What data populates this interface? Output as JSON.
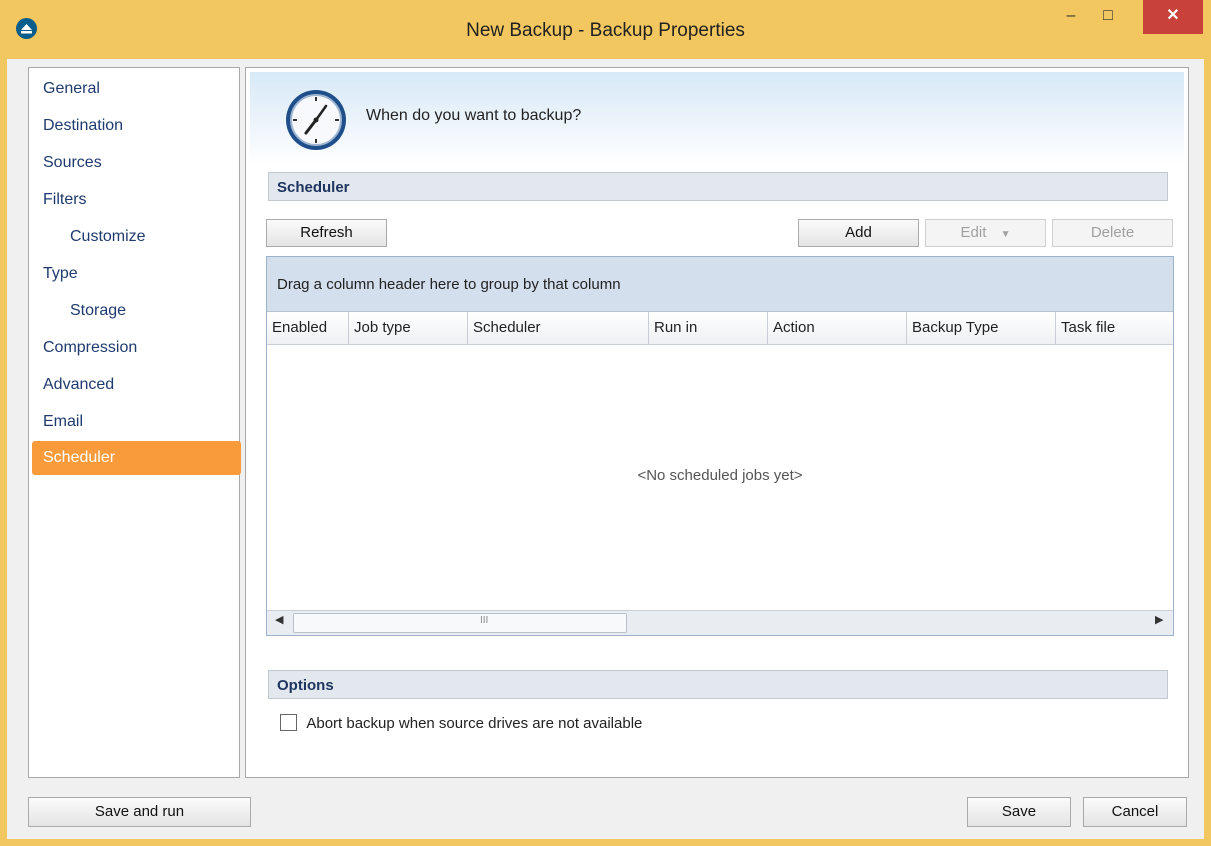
{
  "window": {
    "title": "New Backup - Backup Properties",
    "controls": {
      "minimize": "–",
      "maximize": "□",
      "close": "✕"
    }
  },
  "sidebar": {
    "items": [
      {
        "label": "General",
        "indent": false,
        "active": false
      },
      {
        "label": "Destination",
        "indent": false,
        "active": false
      },
      {
        "label": "Sources",
        "indent": false,
        "active": false
      },
      {
        "label": "Filters",
        "indent": false,
        "active": false
      },
      {
        "label": "Customize",
        "indent": true,
        "active": false
      },
      {
        "label": "Type",
        "indent": false,
        "active": false
      },
      {
        "label": "Storage",
        "indent": true,
        "active": false
      },
      {
        "label": "Compression",
        "indent": false,
        "active": false
      },
      {
        "label": "Advanced",
        "indent": false,
        "active": false
      },
      {
        "label": "Email",
        "indent": false,
        "active": false
      },
      {
        "label": "Scheduler",
        "indent": false,
        "active": true
      }
    ]
  },
  "banner": {
    "text": "When do you want to backup?",
    "icon": "clock-icon"
  },
  "scheduler": {
    "section_title": "Scheduler",
    "buttons": {
      "refresh": "Refresh",
      "add": "Add",
      "edit": "Edit",
      "delete": "Delete"
    },
    "grid": {
      "group_hint": "Drag a column header here to group by that column",
      "columns": [
        "Enabled",
        "Job type",
        "Scheduler",
        "Run in",
        "Action",
        "Backup Type",
        "Task file"
      ],
      "empty_message": "<No scheduled jobs yet>",
      "scroll_grip": "III"
    }
  },
  "options": {
    "section_title": "Options",
    "abort_checkbox_label": "Abort backup when source drives are not available",
    "abort_checked": false
  },
  "footer": {
    "save_and_run": "Save and run",
    "save": "Save",
    "cancel": "Cancel"
  },
  "colors": {
    "frame": "#f2c75f",
    "active_nav": "#f99b3a",
    "close_button": "#c8413a"
  }
}
